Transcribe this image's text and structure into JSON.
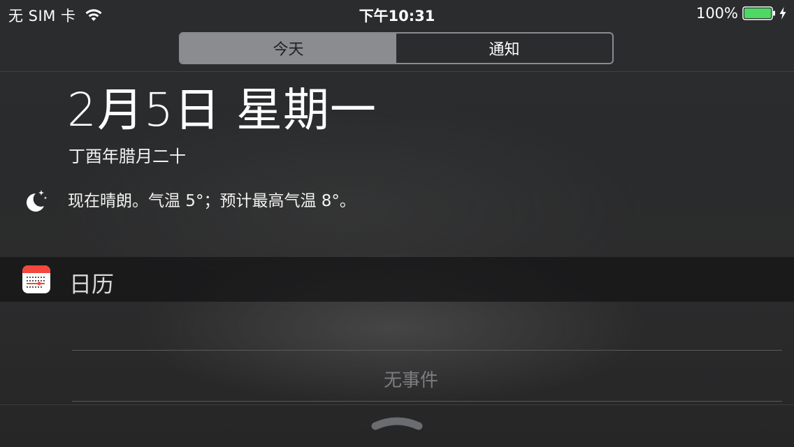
{
  "status_bar": {
    "carrier": "无 SIM 卡",
    "time": "下午10:31",
    "battery_percent": "100%",
    "battery_level": 1.0,
    "icons": [
      "wifi-icon",
      "battery-icon",
      "charging-bolt-icon"
    ]
  },
  "tabs": [
    {
      "label": "今天",
      "active": true
    },
    {
      "label": "通知",
      "active": false
    }
  ],
  "today": {
    "date": "2月5日 星期一",
    "lunar_date": "丁酉年腊月二十",
    "weather_icon": "moon-stars-icon",
    "weather_text": "现在晴朗。气温 5°；预计最高气温 8°。"
  },
  "calendar_widget": {
    "icon": "calendar-app-icon",
    "title": "日历",
    "empty_text": "无事件"
  },
  "colors": {
    "accent_red": "#f5473c",
    "battery_green": "#4cd964",
    "segment_active": "#8a8c90"
  }
}
